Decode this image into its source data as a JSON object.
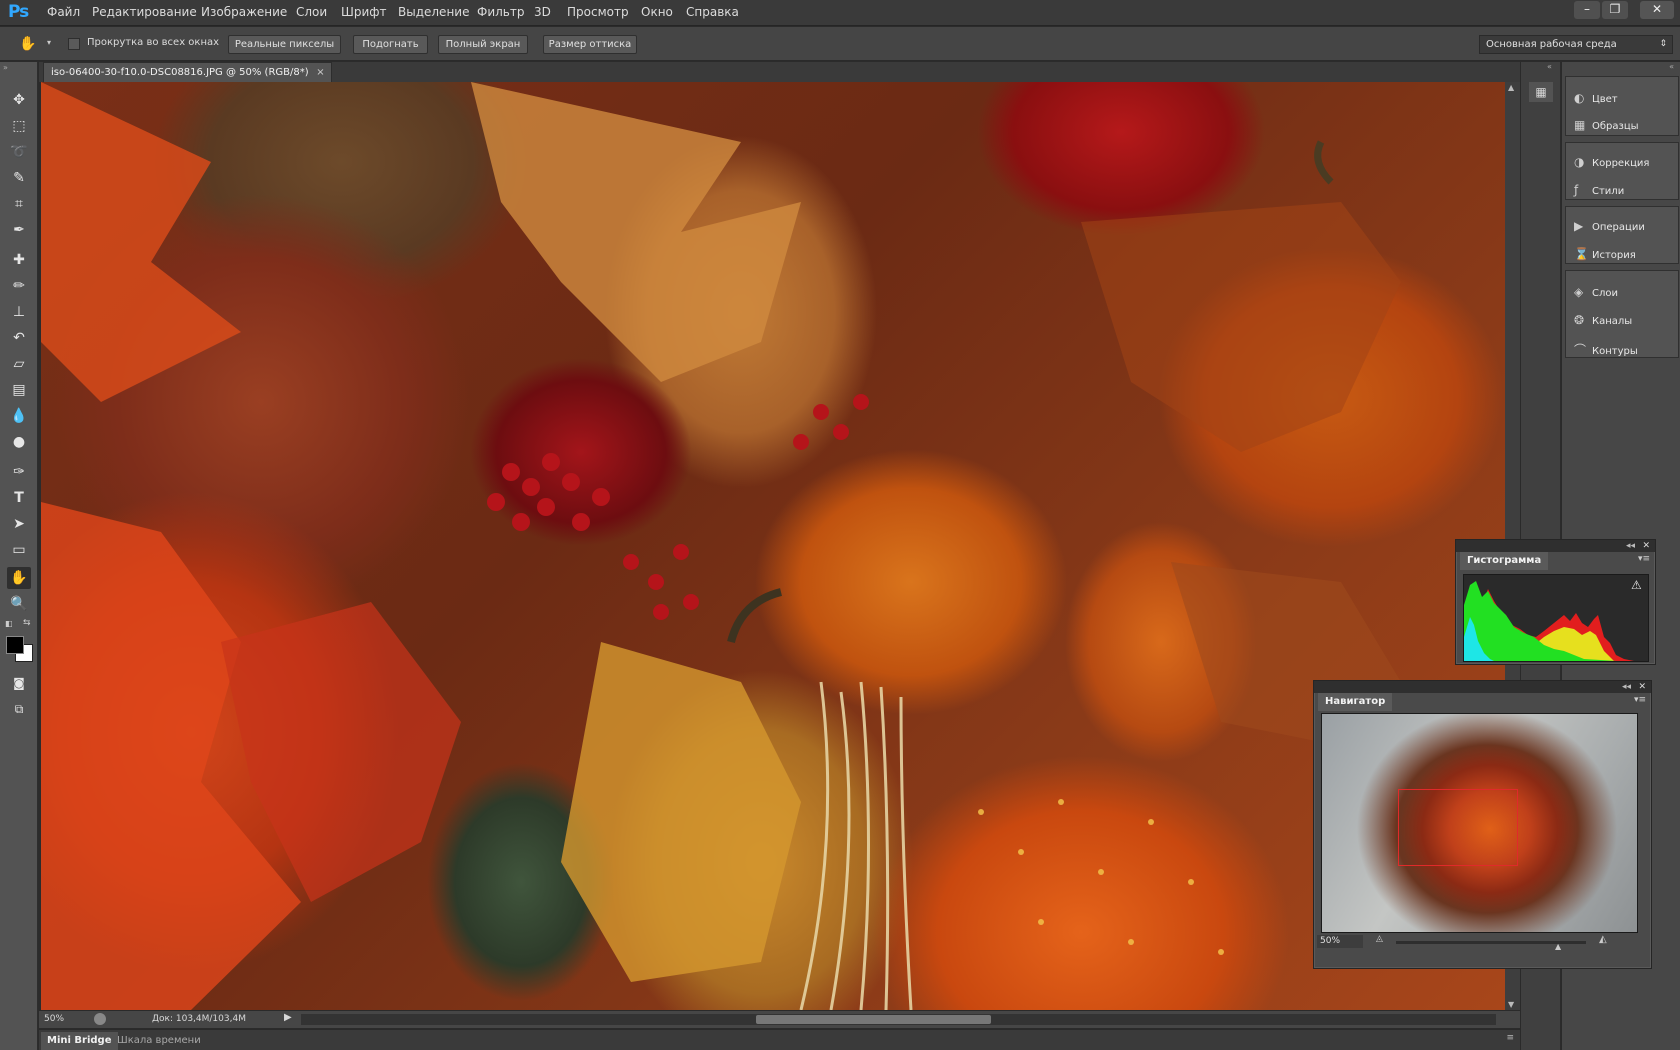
{
  "app": {
    "logo": "Ps"
  },
  "menu": [
    "Файл",
    "Редактирование",
    "Изображение",
    "Слои",
    "Шрифт",
    "Выделение",
    "Фильтр",
    "3D",
    "Просмотр",
    "Окно",
    "Справка"
  ],
  "window_controls": {
    "minimize": "–",
    "restore": "❐",
    "close": "✕"
  },
  "options": {
    "scroll_all_label": "Прокрутка во всех окнах",
    "scroll_all_checked": false,
    "buttons": [
      "Реальные пикселы",
      "Подогнать",
      "Полный экран",
      "Размер оттиска"
    ],
    "workspace": "Основная рабочая среда"
  },
  "document": {
    "tab_title": "iso-06400-30-f10.0-DSC08816.JPG @ 50% (RGB/8*)",
    "tab_close": "×"
  },
  "tools": [
    "move-tool",
    "marquee-tool",
    "lasso-tool",
    "quick-selection-tool",
    "crop-tool",
    "eyedropper-tool",
    "healing-brush-tool",
    "brush-tool",
    "clone-stamp-tool",
    "history-brush-tool",
    "eraser-tool",
    "gradient-tool",
    "blur-tool",
    "dodge-tool",
    "pen-tool",
    "type-tool",
    "path-selection-tool",
    "rectangle-tool",
    "hand-tool",
    "zoom-tool"
  ],
  "active_tool": "hand-tool",
  "colors": {
    "foreground": "#000000",
    "background": "#ffffff",
    "accent": "#31a8ff",
    "nav_view_box": "#e02a2a"
  },
  "status": {
    "zoom": "50%",
    "doc_size": "Док: 103,4M/103,4M"
  },
  "bottom_tabs": [
    "Mini Bridge",
    "Шкала времени"
  ],
  "dock": {
    "groups": [
      {
        "items": [
          {
            "label": "Цвет",
            "icon": "color-icon"
          },
          {
            "label": "Образцы",
            "icon": "swatches-icon"
          }
        ]
      },
      {
        "items": [
          {
            "label": "Коррекция",
            "icon": "adjustments-icon"
          },
          {
            "label": "Стили",
            "icon": "styles-icon"
          }
        ]
      },
      {
        "items": [
          {
            "label": "Операции",
            "icon": "actions-icon"
          },
          {
            "label": "История",
            "icon": "history-icon"
          }
        ]
      },
      {
        "items": [
          {
            "label": "Слои",
            "icon": "layers-icon"
          },
          {
            "label": "Каналы",
            "icon": "channels-icon"
          },
          {
            "label": "Контуры",
            "icon": "paths-icon"
          }
        ]
      }
    ]
  },
  "histogram": {
    "title": "Гистограмма",
    "warning": "⚠"
  },
  "navigator": {
    "title": "Навигатор",
    "zoom": "50%",
    "slider_fraction": 0.86
  }
}
